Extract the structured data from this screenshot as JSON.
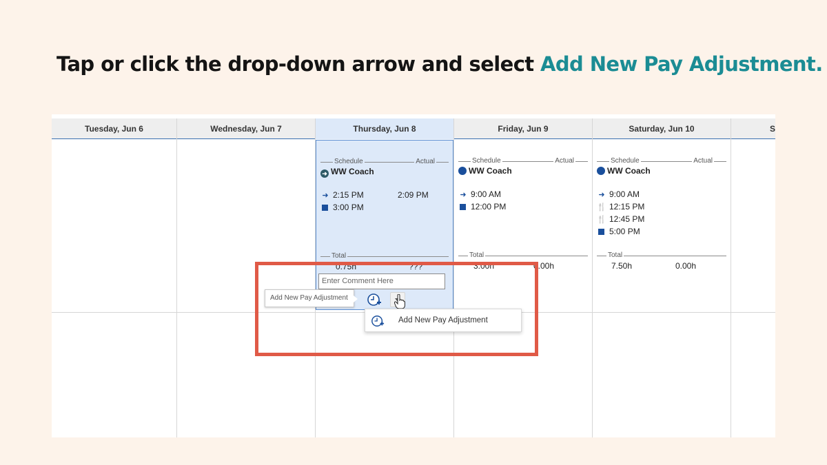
{
  "instruction": {
    "prefix": "Tap or click the drop-down arrow and select",
    "highlight": "Add New Pay Adjustment."
  },
  "calendar": {
    "days": [
      {
        "label": "Tuesday, Jun 6"
      },
      {
        "label": "Wednesday, Jun 7"
      },
      {
        "label": "Thursday, Jun 8",
        "selected": true
      },
      {
        "label": "Friday, Jun 9"
      },
      {
        "label": "Saturday, Jun 10"
      },
      {
        "label": "S"
      }
    ],
    "schedule_label": "Schedule",
    "actual_label": "Actual",
    "total_label": "Total",
    "thursday": {
      "coach": "WW Coach",
      "in_time": "2:15 PM",
      "in_actual": "2:09 PM",
      "out_time": "3:00 PM",
      "total": "0.75h",
      "total_actual": "???"
    },
    "friday": {
      "coach": "WW Coach",
      "in_time": "9:00 AM",
      "out_time": "12:00 PM",
      "total": "3.00h",
      "total_actual": "0.00h"
    },
    "saturday": {
      "coach": "WW Coach",
      "in_time": "9:00 AM",
      "meal_start": "12:15 PM",
      "meal_end": "12:45 PM",
      "out_time": "5:00 PM",
      "total": "7.50h",
      "total_actual": "0.00h"
    }
  },
  "comment": {
    "placeholder": "Enter Comment Here"
  },
  "tooltip": {
    "label": "Add New Pay Adjustment"
  },
  "menu": {
    "item_label": "Add New Pay Adjustment"
  },
  "colors": {
    "accent": "#1b8c94",
    "highlight_box": "#e05a47",
    "selected_day": "#dde9f9",
    "icon_blue": "#1a4f9c"
  }
}
